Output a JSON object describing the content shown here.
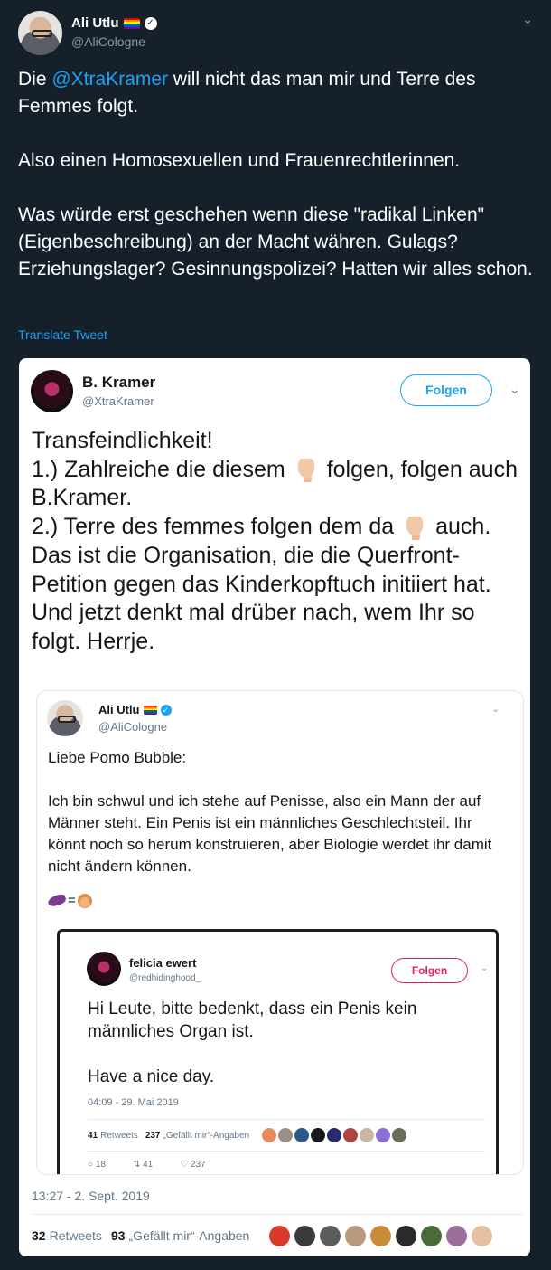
{
  "tweet": {
    "author_name": "Ali Utlu",
    "author_handle": "@AliCologne",
    "text_prefix": "Die ",
    "mention": "@XtraKramer",
    "text_suffix": " will nicht das man mir und Terre des Femmes folgt.",
    "paragraph_2": "Also einen Homosexuellen und Frauenrechtlerinnen.",
    "paragraph_3": "Was würde erst geschehen wenn diese \"radikal Linken\" (Eigenbeschreibung) an der Macht währen. Gulags? Erziehungslager? Gesinnungspolizei? Hatten wir alles schon.",
    "translate_label": "Translate Tweet",
    "menu_icon": "chevron-down-icon"
  },
  "embedded": {
    "author_name": "B. Kramer",
    "author_handle": "@XtraKramer",
    "follow_label": "Folgen",
    "line_1": "Transfeindlichkeit!",
    "line_2a": "1.) Zahlreiche die diesem",
    "line_2b": "folgen, folgen auch B.Kramer.",
    "line_3a": "2.) Terre des femmes folgen dem da",
    "line_3b": "auch. Das ist die Organisation, die die Querfront-Petition gegen das Kinderkopftuch initiiert hat.",
    "line_4": "Und jetzt denkt mal drüber nach, wem Ihr so folgt. Herrje.",
    "date": "13:27 - 2. Sept. 2019",
    "retweets_count": "32",
    "retweets_label": "Retweets",
    "likes_count": "93",
    "likes_label": "„Gefällt mir“-Angaben"
  },
  "quoted": {
    "author_name": "Ali Utlu",
    "author_handle": "@AliCologne",
    "paragraph_1": "Liebe Pomo Bubble:",
    "paragraph_2": "Ich bin schwul und ich stehe auf Penisse, also ein Mann der auf Männer steht. Ein Penis ist ein männliches Geschlechtsteil. Ihr könnt noch so herum konstruieren, aber Biologie werdet ihr damit nicht ändern können.",
    "emoji_equals": "="
  },
  "nested": {
    "author_name": "felicia ewert",
    "author_handle": "@redhidinghood_",
    "follow_label": "Folgen",
    "paragraph_1": "Hi Leute, bitte bedenkt, dass ein Penis kein männliches Organ ist.",
    "paragraph_2": "Have a nice day.",
    "date": "04:09 - 29. Mai 2019",
    "retweets_count": "41",
    "retweets_label": "Retweets",
    "likes_count": "237",
    "likes_label": "„Gefällt mir“-Angaben",
    "reply_count": "18",
    "retweet_count": "41",
    "like_count": "237"
  },
  "colors": {
    "background": "#15202b",
    "link": "#1da1f2",
    "follow_red": "#e0245e"
  }
}
